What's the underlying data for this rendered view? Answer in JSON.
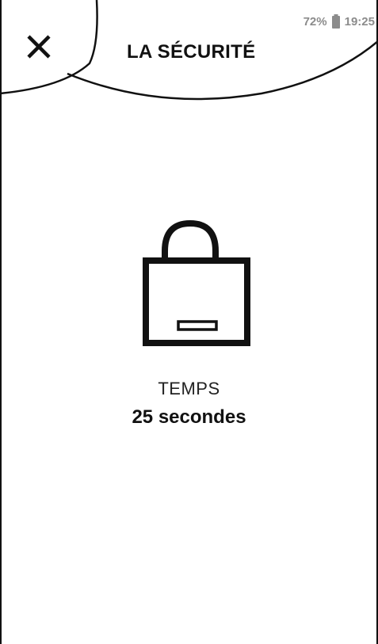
{
  "status_bar": {
    "battery": "72%",
    "time": "19:25",
    "battery_icon": "battery-icon"
  },
  "header": {
    "title": "LA SÉCURITÉ",
    "close_icon": "close-icon"
  },
  "lock": {
    "icon": "unlocked-padlock-icon",
    "label": "TEMPS",
    "value": "25 secondes"
  },
  "colors": {
    "foreground": "#111111",
    "status_text": "#8c8c8c",
    "background": "#ffffff"
  }
}
